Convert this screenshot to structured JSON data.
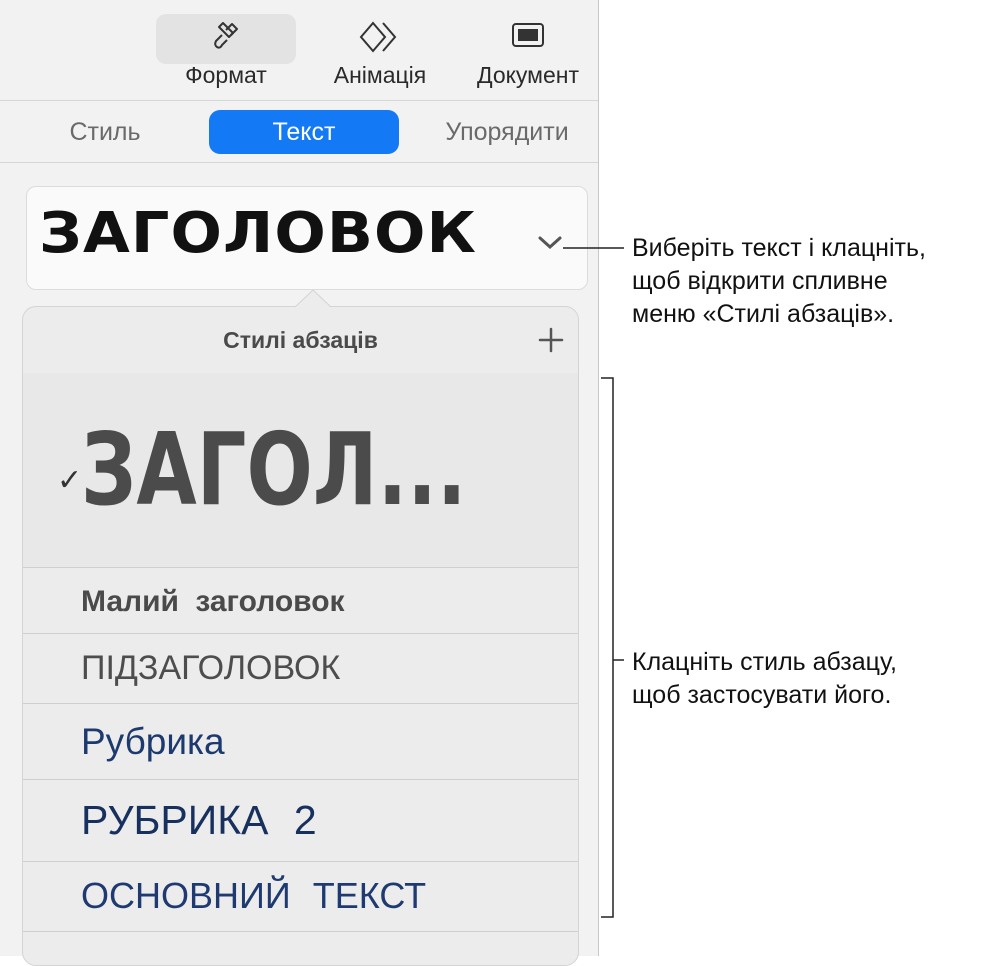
{
  "toolbar": {
    "format_label": "Формат",
    "animation_label": "Анімація",
    "document_label": "Документ"
  },
  "tabs": {
    "style": "Стиль",
    "text": "Текст",
    "arrange": "Упорядити",
    "active": "Текст"
  },
  "paragraph_style": {
    "current": "ЗАГОЛОВОК"
  },
  "popover": {
    "title": "Стилі абзаців",
    "styles": [
      {
        "label": "ЗАГОЛ...",
        "selected": true
      },
      {
        "label": "Малий заголовок"
      },
      {
        "label": "ПІДЗАГОЛОВОК"
      },
      {
        "label": "Рубрика"
      },
      {
        "label": "РУБРИКА 2"
      },
      {
        "label": "ОСНОВНИЙ ТЕКСТ"
      }
    ]
  },
  "callouts": {
    "popup_line1": "Виберіть текст і клацніть,",
    "popup_line2": "щоб відкрити спливне",
    "popup_line3": "меню «Стилі абзаців».",
    "apply_line1": "Клацніть стиль абзацу,",
    "apply_line2": "щоб застосувати його."
  },
  "colors": {
    "accent": "#1479f5",
    "heading_style_blue": "#1d3a6e"
  }
}
